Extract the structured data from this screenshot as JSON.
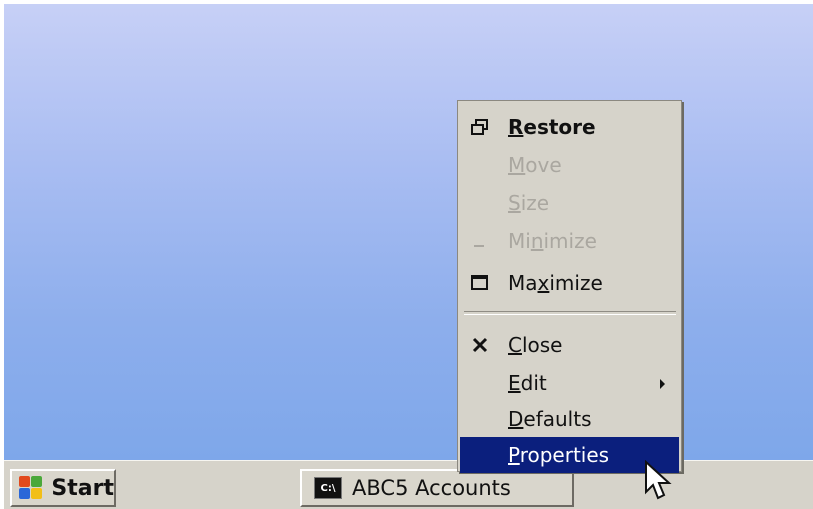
{
  "taskbar": {
    "start_label": "Start",
    "task_label": "ABC5 Accounts",
    "task_icon_text": "C:\\"
  },
  "menu": {
    "items": [
      {
        "label_pre": "",
        "label_u": "R",
        "label_post": "estore",
        "icon": "restore-icon",
        "state": "enabled-bold"
      },
      {
        "label_pre": "",
        "label_u": "M",
        "label_post": "ove",
        "icon": "",
        "state": "disabled"
      },
      {
        "label_pre": "",
        "label_u": "S",
        "label_post": "ize",
        "icon": "",
        "state": "disabled"
      },
      {
        "label_pre": "Mi",
        "label_u": "n",
        "label_post": "imize",
        "icon": "minimize-icon",
        "state": "disabled"
      },
      {
        "label_pre": "Ma",
        "label_u": "x",
        "label_post": "imize",
        "icon": "maximize-icon",
        "state": "enabled"
      },
      {
        "label_pre": "",
        "label_u": "C",
        "label_post": "lose",
        "icon": "close-icon",
        "state": "enabled"
      },
      {
        "label_pre": "",
        "label_u": "E",
        "label_post": "dit",
        "icon": "submenu-arrow-icon",
        "state": "enabled"
      },
      {
        "label_pre": "",
        "label_u": "D",
        "label_post": "efaults",
        "icon": "",
        "state": "enabled"
      },
      {
        "label_pre": "",
        "label_u": "P",
        "label_post": "roperties",
        "icon": "",
        "state": "selected"
      }
    ]
  },
  "colors": {
    "desktop_top": "#c7d0f6",
    "desktop_bottom": "#7ea7ea",
    "menu_bg": "#d6d3ca",
    "selection": "#0b1f7d"
  }
}
